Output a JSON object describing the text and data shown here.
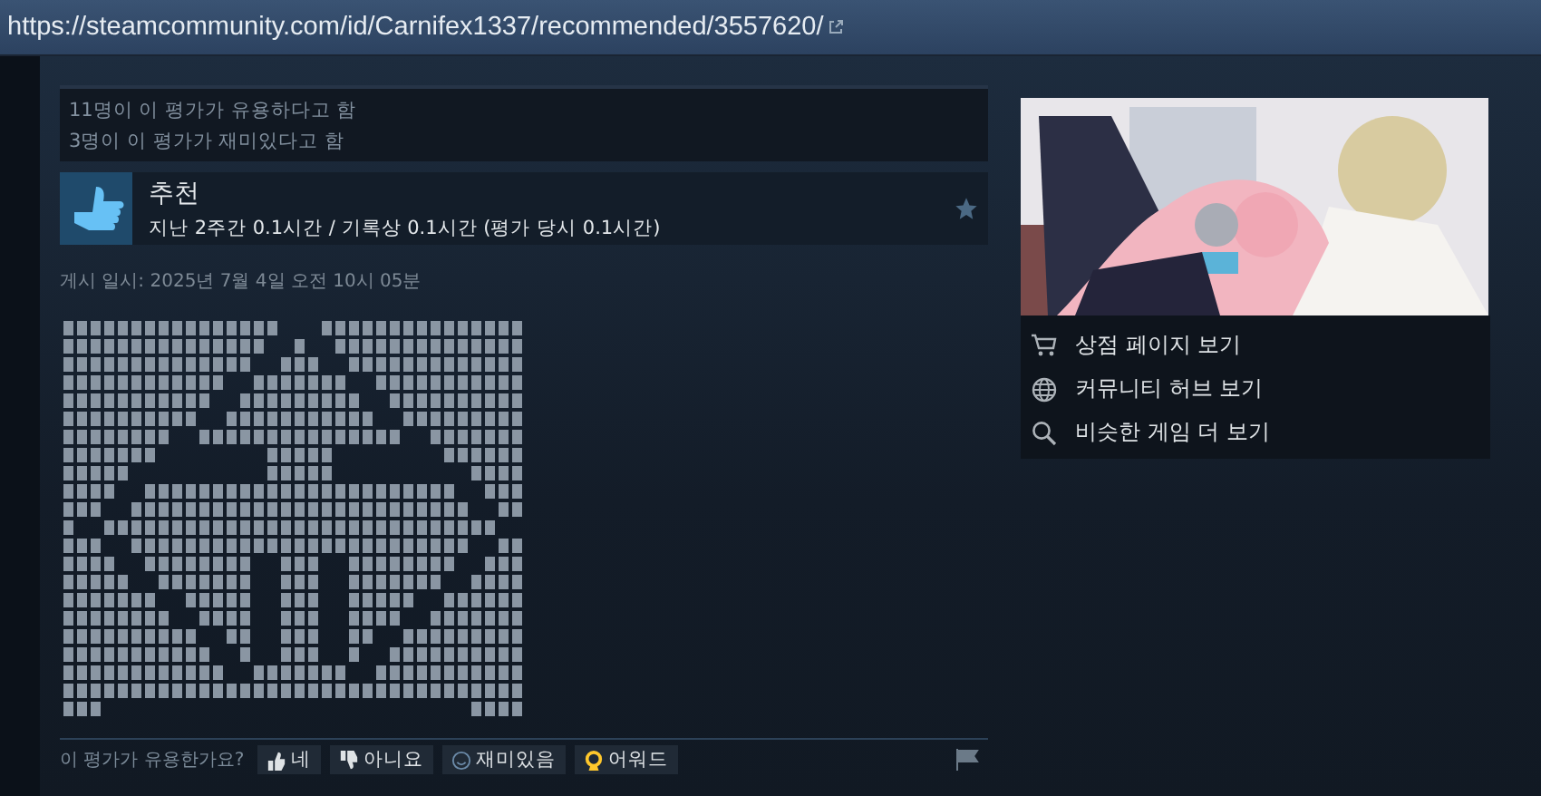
{
  "address_bar": {
    "url": "https://steamcommunity.com/id/Carnifex1337/recommended/3557620/"
  },
  "review": {
    "ratings": [
      "11명이 이 평가가 유용하다고 함",
      "3명이 이 평가가 재미있다고 함"
    ],
    "verdict": "추천",
    "playtime": "지난 2주간 0.1시간 / 기록상 0.1시간 (평가 당시 0.1시간)",
    "posted": "게시 일시: 2025년 7월 4일 오전 10시 05분",
    "body": {
      "kind": "picture"
    },
    "footer": {
      "question": "이 평가가 유용한가요?",
      "buttons": [
        {
          "kind": "yes",
          "label": "네"
        },
        {
          "kind": "no",
          "label": "아니요"
        },
        {
          "kind": "funny",
          "label": "재미있음"
        },
        {
          "kind": "award",
          "label": "어워드"
        }
      ]
    }
  },
  "game": {
    "image": {
      "kind": "picture"
    },
    "links": [
      {
        "kind": "store",
        "label": "상점 페이지 보기"
      },
      {
        "kind": "hub",
        "label": "커뮤니티 허브 보기"
      },
      {
        "kind": "similar",
        "label": "비슷한 게임 더 보기"
      }
    ]
  }
}
